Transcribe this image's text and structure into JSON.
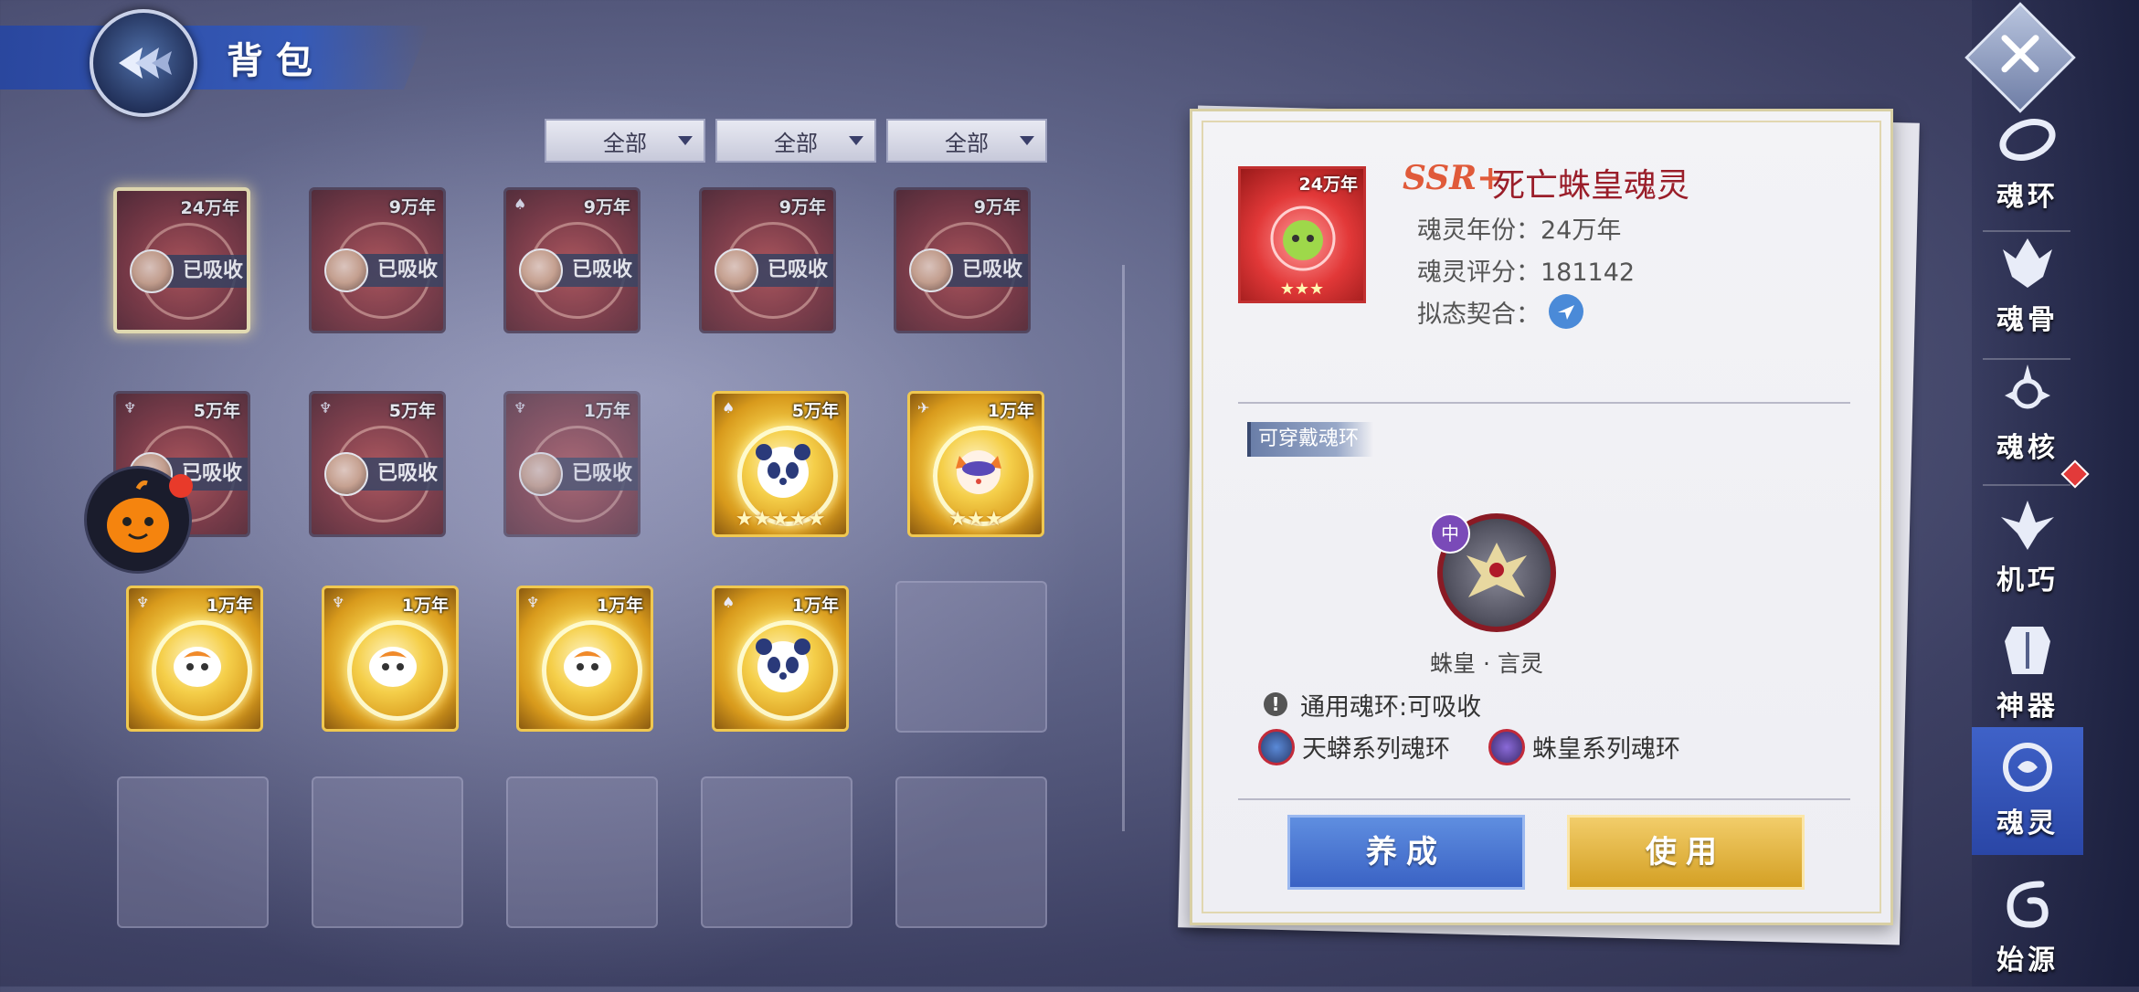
{
  "header": {
    "title": "背包"
  },
  "filters": [
    {
      "label": "全部"
    },
    {
      "label": "全部"
    },
    {
      "label": "全部"
    }
  ],
  "grid": {
    "absorbed_label": "已吸收",
    "rows": [
      [
        {
          "years": "24万年",
          "absorbed": true,
          "selected": true,
          "style": "red"
        },
        {
          "years": "9万年",
          "absorbed": true,
          "style": "red"
        },
        {
          "years": "9万年",
          "absorbed": true,
          "style": "red"
        },
        {
          "years": "9万年",
          "absorbed": true,
          "style": "red"
        },
        {
          "years": "9万年",
          "absorbed": true,
          "style": "red"
        }
      ],
      [
        {
          "years": "5万年",
          "absorbed": true,
          "style": "red"
        },
        {
          "years": "5万年",
          "absorbed": true,
          "style": "red"
        },
        {
          "years": "1万年",
          "absorbed": true,
          "style": "red"
        },
        {
          "years": "5万年",
          "absorbed": false,
          "style": "gold",
          "stars": "★★★★★"
        },
        {
          "years": "1万年",
          "absorbed": false,
          "style": "gold",
          "stars": "★★★"
        }
      ],
      [
        {
          "years": "1万年",
          "absorbed": false,
          "style": "gold"
        },
        {
          "years": "1万年",
          "absorbed": false,
          "style": "gold"
        },
        {
          "years": "1万年",
          "absorbed": false,
          "style": "gold"
        },
        {
          "years": "1万年",
          "absorbed": false,
          "style": "gold"
        },
        {
          "empty": true
        }
      ]
    ]
  },
  "detail": {
    "icon_years": "24万年",
    "icon_stars": "★★★",
    "rarity": "SSR+",
    "name": "死亡蛛皇魂灵",
    "years_line": "魂灵年份：24万年",
    "score_line": "魂灵评分：181142",
    "mimic_line": "拟态契合：",
    "section_label": "可穿戴魂环",
    "ring_badge": "中",
    "ring_name": "蛛皇 · 言灵",
    "note_icon": "!",
    "note": "通用魂环:可吸收",
    "series": [
      {
        "label": "天蟒系列魂环"
      },
      {
        "label": "蛛皇系列魂环"
      }
    ],
    "buttons": {
      "develop": "养成",
      "use": "使用"
    }
  },
  "side_nav": [
    {
      "label": "魂环",
      "icon": "soul-ring-icon"
    },
    {
      "label": "魂骨",
      "icon": "soul-bone-icon"
    },
    {
      "label": "魂核",
      "icon": "soul-core-icon"
    },
    {
      "label": "机巧",
      "icon": "mechanism-icon"
    },
    {
      "label": "神器",
      "icon": "artifact-icon"
    },
    {
      "label": "魂灵",
      "icon": "soul-spirit-icon",
      "active": true
    },
    {
      "label": "始源",
      "icon": "origin-icon"
    }
  ],
  "colors": {
    "accent_blue": "#3a62c4",
    "accent_gold": "#d4a024",
    "item_name": "#9a1e2a",
    "rarity": "#e05a3a"
  }
}
